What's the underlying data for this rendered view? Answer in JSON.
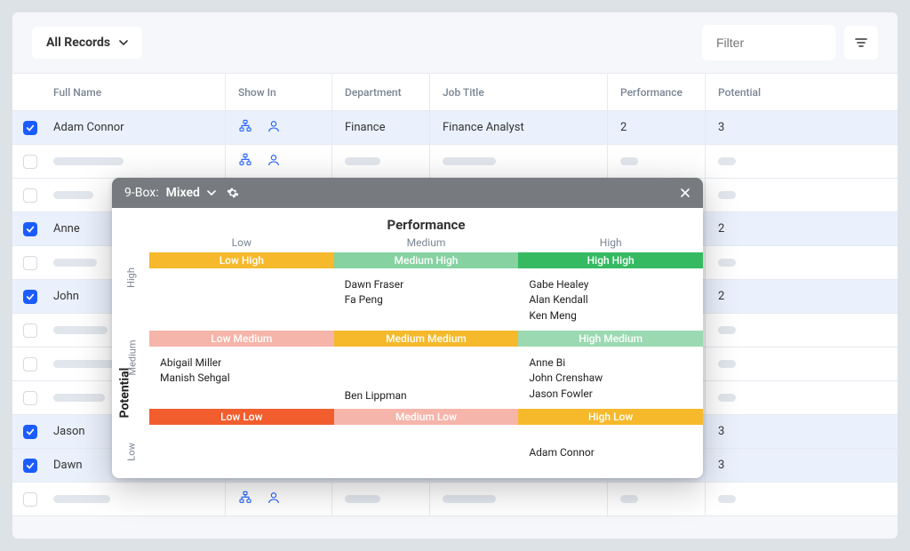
{
  "toolbar": {
    "records_label": "All Records",
    "filter_placeholder": "Filter"
  },
  "columns": {
    "full_name": "Full Name",
    "show_in": "Show In",
    "department": "Department",
    "job_title": "Job Title",
    "performance": "Performance",
    "potential": "Potential"
  },
  "rows": [
    {
      "selected": true,
      "name": "Adam Connor",
      "dept": "Finance",
      "job": "Finance Analyst",
      "perf": "2",
      "pot": "3",
      "skeleton": false
    },
    {
      "selected": false,
      "skeleton": true
    },
    {
      "selected": false,
      "skeleton": true
    },
    {
      "selected": true,
      "name": "Anne",
      "pot": "2",
      "skeleton": false,
      "partial": true
    },
    {
      "selected": false,
      "skeleton": true
    },
    {
      "selected": true,
      "name": "John",
      "pot": "2",
      "skeleton": false,
      "partial": true
    },
    {
      "selected": false,
      "skeleton": true
    },
    {
      "selected": false,
      "skeleton": true
    },
    {
      "selected": false,
      "skeleton": true
    },
    {
      "selected": true,
      "name": "Jason",
      "pot": "3",
      "skeleton": false,
      "partial": true
    },
    {
      "selected": true,
      "name": "Dawn",
      "pot": "3",
      "skeleton": false,
      "partial": true
    },
    {
      "selected": false,
      "skeleton": true
    }
  ],
  "modal": {
    "title_prefix": "9-Box:",
    "title_mode": "Mixed",
    "x_axis_title": "Performance",
    "y_axis_title": "Potential",
    "x_labels": [
      "Low",
      "Medium",
      "High"
    ],
    "y_labels": [
      "High",
      "Medium",
      "Low"
    ],
    "cells": {
      "r0": {
        "headers": [
          "Low High",
          "Medium High",
          "High High"
        ],
        "colors": [
          "c-ylw",
          "c-grn-l",
          "c-grn"
        ],
        "people": [
          [],
          [
            "Dawn Fraser",
            "Fa Peng"
          ],
          [
            "Gabe Healey",
            "Alan Kendall",
            "Ken Meng"
          ]
        ]
      },
      "r1": {
        "headers": [
          "Low Medium",
          "Medium Medium",
          "High Medium"
        ],
        "colors": [
          "c-pnk",
          "c-ylw2",
          "c-grn-m"
        ],
        "people": [
          [
            "Abigail Miller",
            "Manish Sehgal"
          ],
          [
            "Ben Lippman"
          ],
          [
            "Anne Bi",
            "John Crenshaw",
            "Jason Fowler"
          ]
        ]
      },
      "r2": {
        "headers": [
          "Low Low",
          "Medium Low",
          "High Low"
        ],
        "colors": [
          "c-red",
          "c-pnk2",
          "c-ylw3"
        ],
        "people": [
          [],
          [],
          [
            "Adam Connor"
          ]
        ]
      }
    }
  }
}
